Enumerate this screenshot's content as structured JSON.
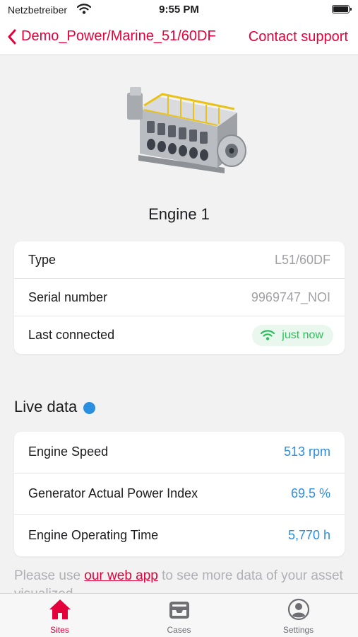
{
  "status_bar": {
    "carrier": "Netzbetreiber",
    "time": "9:55 PM"
  },
  "nav": {
    "back_label": "Demo_Power/Marine_51/60DF",
    "contact_label": "Contact support",
    "accent_color": "#e4003a"
  },
  "engine": {
    "name": "Engine 1"
  },
  "info": {
    "type_label": "Type",
    "type_value": "L51/60DF",
    "serial_label": "Serial number",
    "serial_value": "9969747_NOI",
    "connected_label": "Last connected",
    "connected_value": "just now",
    "connected_icon": "wifi-icon",
    "connected_color": "#2dbf5a"
  },
  "live": {
    "heading": "Live data",
    "indicator_color": "#2a8fe0",
    "rows": [
      {
        "label": "Engine Speed",
        "value": "513 rpm"
      },
      {
        "label": "Generator Actual Power Index",
        "value": "69.5 %"
      },
      {
        "label": "Engine Operating Time",
        "value": "5,770 h"
      }
    ]
  },
  "footnote": {
    "before": "Please use ",
    "link": "our web app",
    "after": " to see more data of your asset visualized"
  },
  "tabs": [
    {
      "label": "Sites",
      "icon": "home-icon",
      "active": true
    },
    {
      "label": "Cases",
      "icon": "inbox-icon",
      "active": false
    },
    {
      "label": "Settings",
      "icon": "person-circle-icon",
      "active": false
    }
  ]
}
